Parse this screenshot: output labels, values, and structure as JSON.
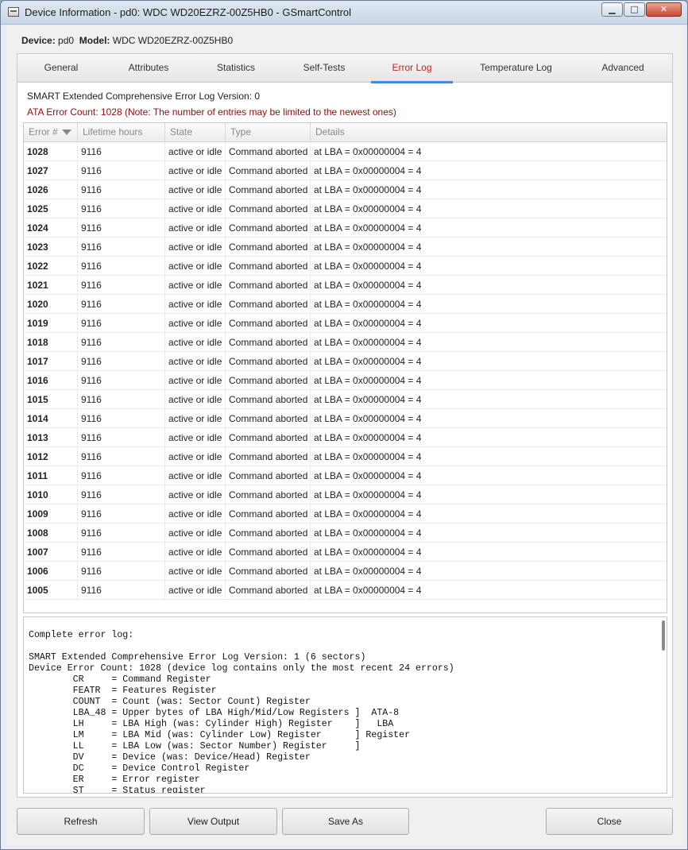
{
  "window": {
    "title": "Device Information - pd0: WDC WD20EZRZ-00Z5HB0 - GSmartControl",
    "minimize_glyph": "▁",
    "maximize_glyph": "□",
    "close_glyph": "✕"
  },
  "device": {
    "device_label": "Device:",
    "device_value": "pd0",
    "model_label": "Model:",
    "model_value": "WDC WD20EZRZ-00Z5HB0"
  },
  "tabs": [
    {
      "label": "General"
    },
    {
      "label": "Attributes"
    },
    {
      "label": "Statistics"
    },
    {
      "label": "Self-Tests"
    },
    {
      "label": "Error Log"
    },
    {
      "label": "Temperature Log"
    },
    {
      "label": "Advanced"
    }
  ],
  "active_tab": "Error Log",
  "error_log": {
    "version_text": "SMART Extended Comprehensive Error Log Version: 0",
    "count_text": "ATA Error Count: 1028 (Note: The number of entries may be limited to the newest ones)",
    "columns": [
      "Error #",
      "Lifetime hours",
      "State",
      "Type",
      "Details"
    ],
    "rows": [
      [
        "1028",
        "9116",
        "active or idle",
        "Command aborted",
        "at LBA = 0x00000004 = 4"
      ],
      [
        "1027",
        "9116",
        "active or idle",
        "Command aborted",
        "at LBA = 0x00000004 = 4"
      ],
      [
        "1026",
        "9116",
        "active or idle",
        "Command aborted",
        "at LBA = 0x00000004 = 4"
      ],
      [
        "1025",
        "9116",
        "active or idle",
        "Command aborted",
        "at LBA = 0x00000004 = 4"
      ],
      [
        "1024",
        "9116",
        "active or idle",
        "Command aborted",
        "at LBA = 0x00000004 = 4"
      ],
      [
        "1023",
        "9116",
        "active or idle",
        "Command aborted",
        "at LBA = 0x00000004 = 4"
      ],
      [
        "1022",
        "9116",
        "active or idle",
        "Command aborted",
        "at LBA = 0x00000004 = 4"
      ],
      [
        "1021",
        "9116",
        "active or idle",
        "Command aborted",
        "at LBA = 0x00000004 = 4"
      ],
      [
        "1020",
        "9116",
        "active or idle",
        "Command aborted",
        "at LBA = 0x00000004 = 4"
      ],
      [
        "1019",
        "9116",
        "active or idle",
        "Command aborted",
        "at LBA = 0x00000004 = 4"
      ],
      [
        "1018",
        "9116",
        "active or idle",
        "Command aborted",
        "at LBA = 0x00000004 = 4"
      ],
      [
        "1017",
        "9116",
        "active or idle",
        "Command aborted",
        "at LBA = 0x00000004 = 4"
      ],
      [
        "1016",
        "9116",
        "active or idle",
        "Command aborted",
        "at LBA = 0x00000004 = 4"
      ],
      [
        "1015",
        "9116",
        "active or idle",
        "Command aborted",
        "at LBA = 0x00000004 = 4"
      ],
      [
        "1014",
        "9116",
        "active or idle",
        "Command aborted",
        "at LBA = 0x00000004 = 4"
      ],
      [
        "1013",
        "9116",
        "active or idle",
        "Command aborted",
        "at LBA = 0x00000004 = 4"
      ],
      [
        "1012",
        "9116",
        "active or idle",
        "Command aborted",
        "at LBA = 0x00000004 = 4"
      ],
      [
        "1011",
        "9116",
        "active or idle",
        "Command aborted",
        "at LBA = 0x00000004 = 4"
      ],
      [
        "1010",
        "9116",
        "active or idle",
        "Command aborted",
        "at LBA = 0x00000004 = 4"
      ],
      [
        "1009",
        "9116",
        "active or idle",
        "Command aborted",
        "at LBA = 0x00000004 = 4"
      ],
      [
        "1008",
        "9116",
        "active or idle",
        "Command aborted",
        "at LBA = 0x00000004 = 4"
      ],
      [
        "1007",
        "9116",
        "active or idle",
        "Command aborted",
        "at LBA = 0x00000004 = 4"
      ],
      [
        "1006",
        "9116",
        "active or idle",
        "Command aborted",
        "at LBA = 0x00000004 = 4"
      ],
      [
        "1005",
        "9116",
        "active or idle",
        "Command aborted",
        "at LBA = 0x00000004 = 4"
      ]
    ],
    "complete_log": "Complete error log:\n\nSMART Extended Comprehensive Error Log Version: 1 (6 sectors)\nDevice Error Count: 1028 (device log contains only the most recent 24 errors)\n        CR     = Command Register\n        FEATR  = Features Register\n        COUNT  = Count (was: Sector Count) Register\n        LBA_48 = Upper bytes of LBA High/Mid/Low Registers ]  ATA-8\n        LH     = LBA High (was: Cylinder High) Register    ]   LBA\n        LM     = LBA Mid (was: Cylinder Low) Register      ] Register\n        LL     = LBA Low (was: Sector Number) Register     ]\n        DV     = Device (was: Device/Head) Register\n        DC     = Device Control Register\n        ER     = Error register\n        ST     = Status register"
  },
  "buttons": {
    "refresh": "Refresh",
    "view_output": "View Output",
    "save_as": "Save As",
    "close": "Close"
  },
  "colors": {
    "active_tab_text": "#b5261a",
    "active_tab_underline": "#3f8bd6",
    "error_count_text": "#8b0f0f"
  }
}
